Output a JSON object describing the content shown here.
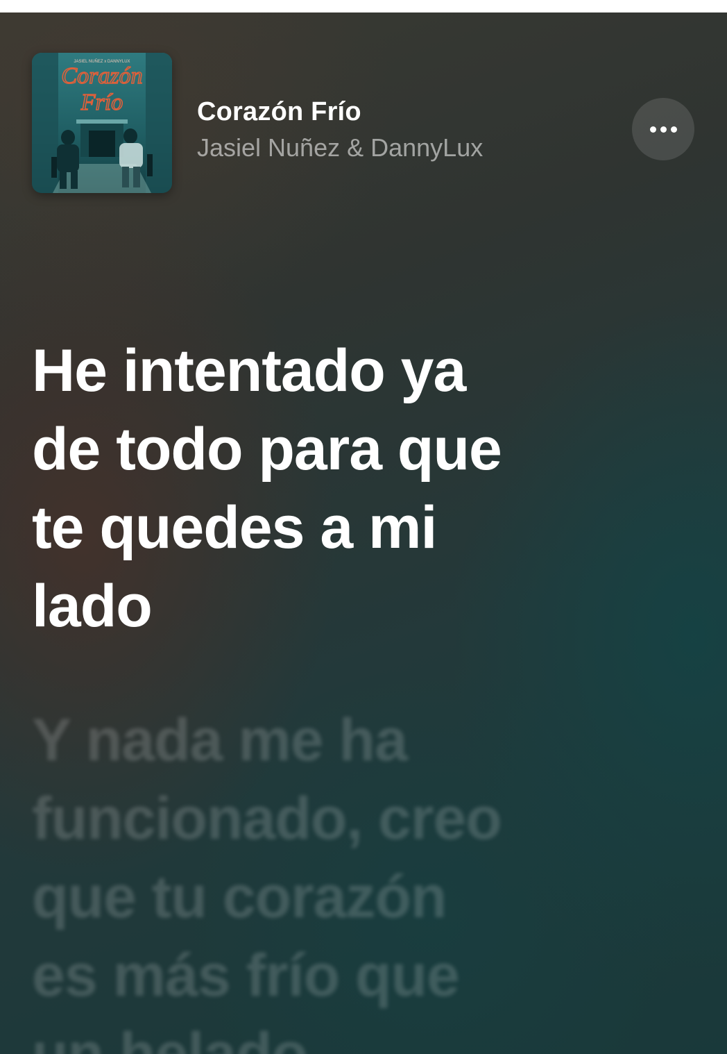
{
  "now_playing": {
    "title": "Corazón Frío",
    "artist": "Jasiel Nuñez & DannyLux",
    "album_art": {
      "title_text": "Corazón Frío",
      "artist_text": "JASIEL NUÑEZ x DANNYLUX",
      "accent": "#e0603a"
    }
  },
  "more_button": {
    "icon": "ellipsis-icon"
  },
  "lyrics": {
    "active_line": "He intentado ya\nde todo para que\nte quedes a mi\nlado",
    "next_line": "Y nada me ha\nfuncionado, creo\nque tu corazón\nes más frío que\nun helado"
  },
  "colors": {
    "background_warm": "#4a3028",
    "background_teal": "#19393a",
    "text_active": "#ffffff"
  }
}
